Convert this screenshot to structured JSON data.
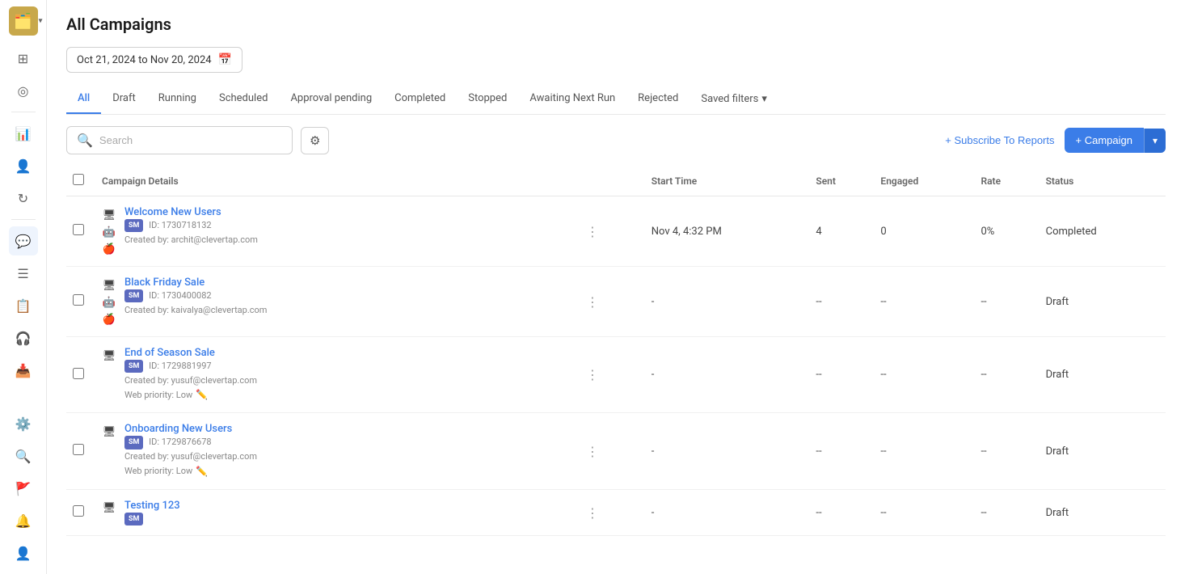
{
  "app": {
    "logo_emoji": "🗂️",
    "title": "All Campaigns"
  },
  "sidebar": {
    "icons": [
      {
        "name": "grid-icon",
        "symbol": "⊞",
        "active": false
      },
      {
        "name": "activity-icon",
        "symbol": "◎",
        "active": false
      },
      {
        "name": "bar-chart-icon",
        "symbol": "📊",
        "active": false
      },
      {
        "name": "users-icon",
        "symbol": "👤",
        "active": false
      },
      {
        "name": "refresh-icon",
        "symbol": "↻",
        "active": false
      },
      {
        "name": "chat-icon",
        "symbol": "💬",
        "active": true
      },
      {
        "name": "list-icon",
        "symbol": "☰",
        "active": false
      },
      {
        "name": "report-icon",
        "symbol": "📋",
        "active": false
      },
      {
        "name": "support-icon",
        "symbol": "🎧",
        "active": false
      },
      {
        "name": "inbox-icon",
        "symbol": "📥",
        "active": false
      }
    ],
    "bottom_icons": [
      {
        "name": "settings-icon",
        "symbol": "⚙️"
      },
      {
        "name": "search-people-icon",
        "symbol": "🔍"
      },
      {
        "name": "flag-icon",
        "symbol": "🚩"
      },
      {
        "name": "bell-icon",
        "symbol": "🔔"
      },
      {
        "name": "person-icon",
        "symbol": "👤"
      }
    ]
  },
  "header": {
    "date_range": "Oct 21, 2024 to Nov 20, 2024"
  },
  "tabs": [
    {
      "label": "All",
      "active": true
    },
    {
      "label": "Draft",
      "active": false
    },
    {
      "label": "Running",
      "active": false
    },
    {
      "label": "Scheduled",
      "active": false
    },
    {
      "label": "Approval pending",
      "active": false
    },
    {
      "label": "Completed",
      "active": false
    },
    {
      "label": "Stopped",
      "active": false
    },
    {
      "label": "Awaiting Next Run",
      "active": false
    },
    {
      "label": "Rejected",
      "active": false
    },
    {
      "label": "Saved filters",
      "active": false
    }
  ],
  "toolbar": {
    "search_placeholder": "Search",
    "subscribe_label": "+ Subscribe To Reports",
    "campaign_label": "+ Campaign"
  },
  "table": {
    "columns": [
      {
        "label": ""
      },
      {
        "label": "Campaign Details"
      },
      {
        "label": ""
      },
      {
        "label": "Start Time"
      },
      {
        "label": "Sent"
      },
      {
        "label": "Engaged"
      },
      {
        "label": "Rate"
      },
      {
        "label": "Status"
      }
    ],
    "rows": [
      {
        "id": 1,
        "name": "Welcome New Users",
        "badge": "SM",
        "campaign_id": "ID: 1730718132",
        "created_by": "Created by: archit@clevertap.com",
        "web_priority": null,
        "device_icons": [
          "🖥",
          "🤖",
          "🍎"
        ],
        "start_time": "Nov 4, 4:32 PM",
        "sent": "4",
        "engaged": "0",
        "rate": "0%",
        "status": "Completed",
        "status_class": "status-completed"
      },
      {
        "id": 2,
        "name": "Black Friday Sale",
        "badge": "SM",
        "campaign_id": "ID: 1730400082",
        "created_by": "Created by: kaivalya@clevertap.com",
        "web_priority": null,
        "device_icons": [
          "🖥",
          "🤖",
          "🍎"
        ],
        "start_time": "-",
        "sent": "--",
        "engaged": "--",
        "rate": "--",
        "status": "Draft",
        "status_class": "status-draft"
      },
      {
        "id": 3,
        "name": "End of Season Sale",
        "badge": "SM",
        "campaign_id": "ID: 1729881997",
        "created_by": "Created by: yusuf@clevertap.com",
        "web_priority": "Web priority: Low",
        "device_icons": [
          "🖥"
        ],
        "start_time": "-",
        "sent": "--",
        "engaged": "--",
        "rate": "--",
        "status": "Draft",
        "status_class": "status-draft"
      },
      {
        "id": 4,
        "name": "Onboarding New Users",
        "badge": "SM",
        "campaign_id": "ID: 1729876678",
        "created_by": "Created by: yusuf@clevertap.com",
        "web_priority": "Web priority: Low",
        "device_icons": [
          "🖥"
        ],
        "start_time": "-",
        "sent": "--",
        "engaged": "--",
        "rate": "--",
        "status": "Draft",
        "status_class": "status-draft"
      },
      {
        "id": 5,
        "name": "Testing 123",
        "badge": "SM",
        "campaign_id": "",
        "created_by": "",
        "web_priority": null,
        "device_icons": [
          "🖥"
        ],
        "start_time": "-",
        "sent": "--",
        "engaged": "--",
        "rate": "--",
        "status": "Draft",
        "status_class": "status-draft"
      }
    ]
  }
}
